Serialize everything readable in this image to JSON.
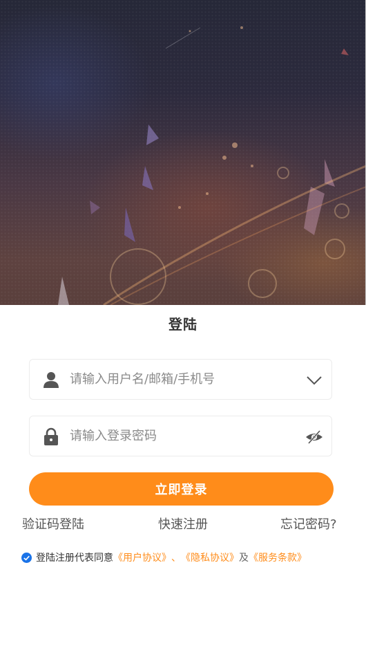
{
  "header": {
    "title": "登陆"
  },
  "form": {
    "username": {
      "placeholder": "请输入用户名/邮箱/手机号",
      "value": ""
    },
    "password": {
      "placeholder": "请输入登录密码",
      "value": ""
    },
    "submit_label": "立即登录"
  },
  "links": {
    "sms_login": "验证码登陆",
    "register": "快速注册",
    "forgot": "忘记密码?"
  },
  "agreement": {
    "prefix": "登陆注册代表同意",
    "user_agreement": "《用户协议》",
    "separator": "、",
    "privacy": "《隐私协议》",
    "and": "及",
    "terms": "《服务条款》",
    "checked": true
  },
  "icons": {
    "user": "user-icon",
    "dropdown": "chevron-down-icon",
    "lock": "lock-icon",
    "eye": "eye-hidden-icon",
    "check": "check-circle-icon"
  },
  "colors": {
    "accent": "#ff8c1a",
    "check": "#1a73e8",
    "icon": "#555555"
  }
}
